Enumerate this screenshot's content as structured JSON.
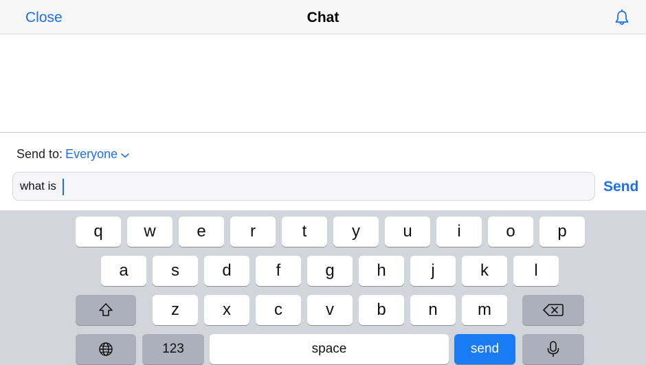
{
  "navbar": {
    "close_label": "Close",
    "title": "Chat",
    "bell_icon": "bell-icon"
  },
  "composer": {
    "send_to_label": "Send to:",
    "send_to_target": "Everyone",
    "input_value": "what is",
    "send_label": "Send"
  },
  "keyboard": {
    "row1": [
      "q",
      "w",
      "e",
      "r",
      "t",
      "y",
      "u",
      "i",
      "o",
      "p"
    ],
    "row2": [
      "a",
      "s",
      "d",
      "f",
      "g",
      "h",
      "j",
      "k",
      "l"
    ],
    "row3": [
      "z",
      "x",
      "c",
      "v",
      "b",
      "n",
      "m"
    ],
    "shift_icon": "shift-icon",
    "backspace_icon": "backspace-icon",
    "globe_icon": "globe-icon",
    "numbers_label": "123",
    "space_label": "space",
    "send_label": "send",
    "mic_icon": "microphone-icon"
  },
  "colors": {
    "accent": "#1e6ff0",
    "keyboard_bg": "#d2d5db",
    "send_key": "#1a7cf5"
  }
}
